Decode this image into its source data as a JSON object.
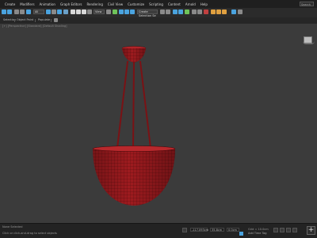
{
  "menubar": {
    "items": [
      "Create",
      "Modifiers",
      "Animation",
      "Graph Editors",
      "Rendering",
      "Civil View",
      "Customize",
      "Scripting",
      "Content",
      "Arnold",
      "Help"
    ],
    "search_placeholder": "Search"
  },
  "toolbar": {
    "filter_dropdown": "All",
    "view_dropdown": "View",
    "selection_set_placeholder": "Create Selection Se"
  },
  "tabs": {
    "items": [
      "Selection",
      "Object Paint",
      "Populate"
    ]
  },
  "viewport": {
    "label": "[+] [Perspective] [Standard] [Default Shading]",
    "model_color": "#9e1b1f",
    "wire_color": "#3d0608"
  },
  "statusbar": {
    "objects_selected": "None Selected",
    "prompt": "Click or click-and-drag to select objects",
    "x_value": "-117.093cm",
    "y_value": "35.8cm",
    "z_value": "0.0cm",
    "grid": "Grid = 10.0cm",
    "add_time_tag": "Add Time Tag"
  },
  "colors": {
    "menubar_bg": "#1f1f1f",
    "toolbar_bg": "#2b2b2b",
    "viewport_bg": "#3b3b3b",
    "icon_blue": "#4aa3df",
    "icon_green": "#6fc35a"
  }
}
